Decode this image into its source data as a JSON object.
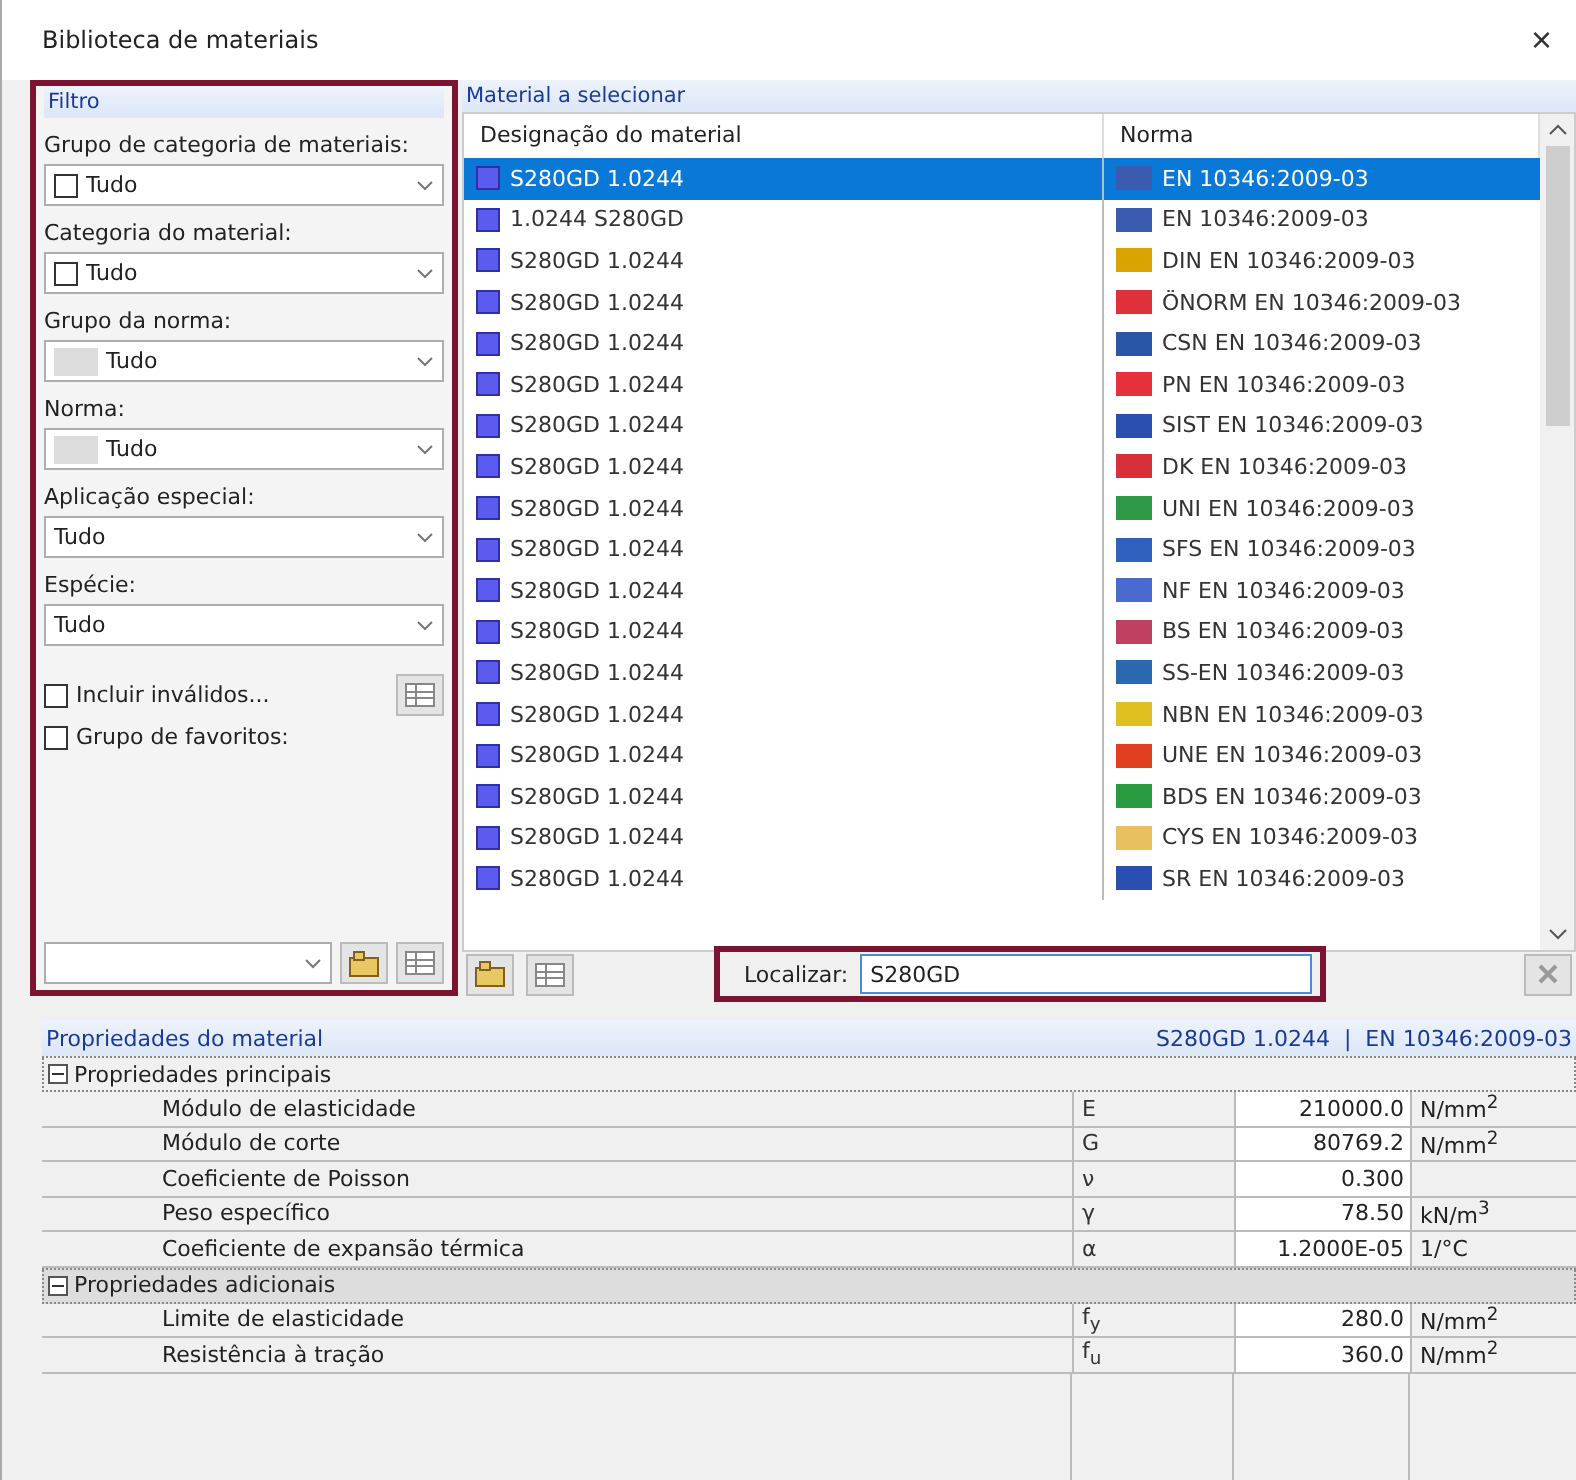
{
  "window": {
    "title": "Biblioteca de materiais",
    "close": "×"
  },
  "filter": {
    "title": "Filtro",
    "fields": [
      {
        "label": "Grupo de categoria de materiais:",
        "value": "Tudo",
        "kind": "checkbox",
        "checked": false
      },
      {
        "label": "Categoria do material:",
        "value": "Tudo",
        "kind": "checkbox",
        "checked": false
      },
      {
        "label": "Grupo da norma:",
        "value": "Tudo",
        "kind": "swatch"
      },
      {
        "label": "Norma:",
        "value": "Tudo",
        "kind": "swatch"
      },
      {
        "label": "Aplicação especial:",
        "value": "Tudo",
        "kind": "plain"
      },
      {
        "label": "Espécie:",
        "value": "Tudo",
        "kind": "plain"
      }
    ],
    "options": [
      {
        "label": "Incluir inválidos...",
        "checked": false
      },
      {
        "label": "Grupo de favoritos:",
        "checked": false
      }
    ]
  },
  "materials": {
    "title": "Material a selecionar",
    "columns": [
      "Designação do material",
      "Norma"
    ],
    "rows": [
      {
        "name": "S280GD 1.0244",
        "norm": "EN 10346:2009-03",
        "color": "#3a5bb0",
        "selected": true
      },
      {
        "name": "1.0244 S280GD",
        "norm": "EN 10346:2009-03",
        "color": "#3a5bb0",
        "selected": false
      },
      {
        "name": "S280GD 1.0244",
        "norm": "DIN EN 10346:2009-03",
        "color": "#d9a400",
        "selected": false
      },
      {
        "name": "S280GD 1.0244",
        "norm": "ÖNORM EN 10346:2009-03",
        "color": "#e0303a",
        "selected": false
      },
      {
        "name": "S280GD 1.0244",
        "norm": "CSN EN 10346:2009-03",
        "color": "#2a56a8",
        "selected": false
      },
      {
        "name": "S280GD 1.0244",
        "norm": "PN EN 10346:2009-03",
        "color": "#e8303c",
        "selected": false
      },
      {
        "name": "S280GD 1.0244",
        "norm": "SIST EN 10346:2009-03",
        "color": "#2a4fb0",
        "selected": false
      },
      {
        "name": "S280GD 1.0244",
        "norm": "DK EN 10346:2009-03",
        "color": "#d8303a",
        "selected": false
      },
      {
        "name": "S280GD 1.0244",
        "norm": "UNI EN 10346:2009-03",
        "color": "#2e9a48",
        "selected": false
      },
      {
        "name": "S280GD 1.0244",
        "norm": "SFS EN 10346:2009-03",
        "color": "#3060c0",
        "selected": false
      },
      {
        "name": "S280GD 1.0244",
        "norm": "NF EN 10346:2009-03",
        "color": "#4a6ad0",
        "selected": false
      },
      {
        "name": "S280GD 1.0244",
        "norm": "BS EN 10346:2009-03",
        "color": "#c04060",
        "selected": false
      },
      {
        "name": "S280GD 1.0244",
        "norm": "SS-EN 10346:2009-03",
        "color": "#2a68b0",
        "selected": false
      },
      {
        "name": "S280GD 1.0244",
        "norm": "NBN EN 10346:2009-03",
        "color": "#e0c020",
        "selected": false
      },
      {
        "name": "S280GD 1.0244",
        "norm": "UNE EN 10346:2009-03",
        "color": "#e04020",
        "selected": false
      },
      {
        "name": "S280GD 1.0244",
        "norm": "BDS EN 10346:2009-03",
        "color": "#2a9a40",
        "selected": false
      },
      {
        "name": "S280GD 1.0244",
        "norm": "CYS EN 10346:2009-03",
        "color": "#e8c060",
        "selected": false
      },
      {
        "name": "S280GD 1.0244",
        "norm": "SR EN 10346:2009-03",
        "color": "#2a4fb0",
        "selected": false
      }
    ]
  },
  "search": {
    "label": "Localizar:",
    "value": "S280GD"
  },
  "properties": {
    "title": "Propriedades do material",
    "current": "S280GD 1.0244  |  EN 10346:2009-03",
    "groups": [
      {
        "name": "Propriedades principais",
        "expanded": true,
        "rows": [
          {
            "name": "Módulo de elasticidade",
            "symbol": "E",
            "value": "210000.0",
            "unit": "N/mm$^{2}$"
          },
          {
            "name": "Módulo de corte",
            "symbol": "G",
            "value": "80769.2",
            "unit": "N/mm$^{2}$"
          },
          {
            "name": "Coeficiente de Poisson",
            "symbol": "ν",
            "value": "0.300"
          },
          {
            "name": "Peso específico",
            "symbol": "γ",
            "value": "78.50",
            "unit": "kN/m$^{3}$"
          },
          {
            "name": "Coeficiente de expansão térmica",
            "symbol": "α",
            "value": "1.2000E-05",
            "unit": "1/°C"
          }
        ]
      },
      {
        "name": "Propriedades adicionais",
        "expanded": true,
        "rows": [
          {
            "name": "Limite de elasticidade",
            "symbol": "f$_{y}$",
            "value": "280.0",
            "unit": "N/mm$^{2}$"
          },
          {
            "name": "Resistência à tração",
            "symbol": "f$_{u}$",
            "value": "360.0",
            "unit": "N/mm$^{2}$"
          }
        ]
      }
    ]
  }
}
